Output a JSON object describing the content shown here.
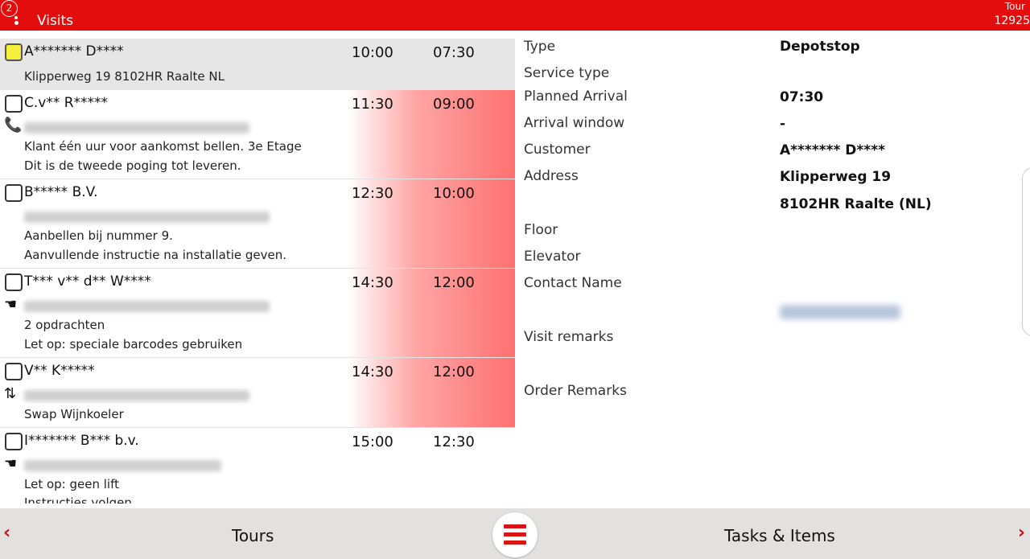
{
  "header": {
    "badge": "2",
    "title": "Visits",
    "tour_label": "Tour",
    "tour_number": "12925"
  },
  "visits": [
    {
      "name": "A******* D****",
      "time_window_start": "10:00",
      "time_planned": "07:30",
      "lines": [
        "Klipperweg 19 8102HR Raalte NL"
      ],
      "selected": true
    },
    {
      "name": "C.v** R*****",
      "time_window_start": "11:30",
      "time_planned": "09:00",
      "lines": [
        "Klant één uur voor aankomst bellen. 3e Etage",
        "Dit is de tweede poging tot leveren."
      ],
      "icon": "phone-icon"
    },
    {
      "name": "B***** B.V.",
      "time_window_start": "12:30",
      "time_planned": "10:00",
      "lines": [
        "Aanbellen bij nummer 9.",
        "Aanvullende instructie na installatie geven."
      ]
    },
    {
      "name": "T*** v** d** W****",
      "time_window_start": "14:30",
      "time_planned": "12:00",
      "lines": [
        "2 opdrachten",
        "Let op: speciale barcodes gebruiken"
      ],
      "icon": "hand-icon"
    },
    {
      "name": "V** K*****",
      "time_window_start": "14:30",
      "time_planned": "12:00",
      "lines": [
        "Swap Wijnkoeler"
      ],
      "icon": "swap-icon"
    },
    {
      "name": "I******* B*** b.v.",
      "time_window_start": "15:00",
      "time_planned": "12:30",
      "lines": [
        "Let op:  geen lift",
        "Instructies volgen"
      ],
      "icon": "hand-icon"
    }
  ],
  "detail": {
    "type_label": "Type",
    "type_value": "Depotstop",
    "service_type_label": "Service type",
    "planned_arrival_label": "Planned Arrival",
    "planned_arrival_value": "07:30",
    "arrival_window_label": "Arrival window",
    "arrival_window_value": "-",
    "customer_label": "Customer",
    "customer_value": "A******* D****",
    "address_label": "Address",
    "address_line1": "Klipperweg 19",
    "address_line2": "8102HR Raalte (NL)",
    "floor_label": "Floor",
    "elevator_label": "Elevator",
    "contact_name_label": "Contact Name",
    "visit_remarks_label": "Visit remarks",
    "order_remarks_label": "Order Remarks"
  },
  "bottom": {
    "prev_arrow": "‹",
    "next_arrow": "›",
    "tours_label": "Tours",
    "tasks_label": "Tasks & Items"
  },
  "colors": {
    "brand_red": "#e30d0d",
    "late_red": "#ff7070",
    "selected_checkbox": "#f3ef3b"
  }
}
